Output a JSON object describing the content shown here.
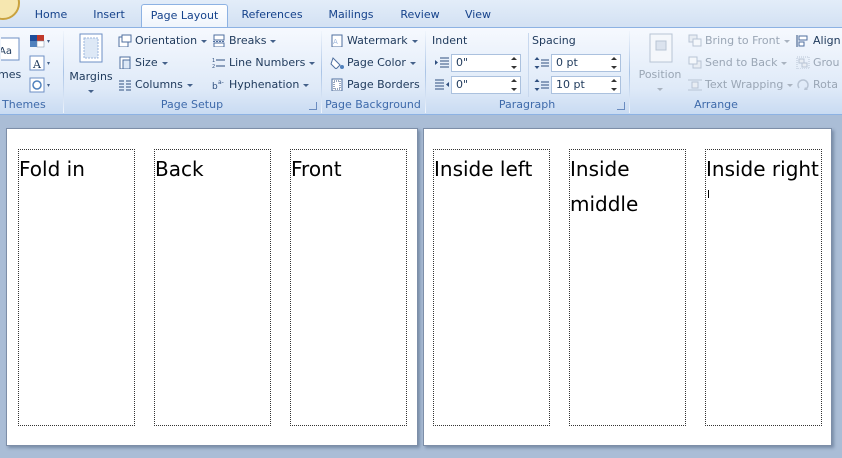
{
  "tabs": [
    {
      "label": "Home",
      "active": false
    },
    {
      "label": "Insert",
      "active": false
    },
    {
      "label": "Page Layout",
      "active": true
    },
    {
      "label": "References",
      "active": false
    },
    {
      "label": "Mailings",
      "active": false
    },
    {
      "label": "Review",
      "active": false
    },
    {
      "label": "View",
      "active": false
    }
  ],
  "ribbon": {
    "themes": {
      "label": "Themes",
      "button_fragment": "mes",
      "icon_text": "Aa"
    },
    "page_setup": {
      "label": "Page Setup",
      "margins": "Margins",
      "orientation": "Orientation",
      "size": "Size",
      "columns": "Columns",
      "breaks": "Breaks",
      "line_numbers": "Line Numbers",
      "hyphenation": "Hyphenation"
    },
    "page_background": {
      "label": "Page Background",
      "watermark": "Watermark",
      "page_color": "Page Color",
      "page_borders": "Page Borders"
    },
    "paragraph": {
      "label": "Paragraph",
      "indent_label": "Indent",
      "spacing_label": "Spacing",
      "indent_left": "0\"",
      "indent_right": "0\"",
      "spacing_before": "0 pt",
      "spacing_after": "10 pt"
    },
    "arrange": {
      "label": "Arrange",
      "position": "Position",
      "bring_to_front": "Bring to Front",
      "send_to_back": "Send to Back",
      "text_wrapping": "Text Wrapping",
      "align": "Align",
      "group": "Grou",
      "rotate": "Rota"
    }
  },
  "document": {
    "page1_panels": [
      "Fold in",
      "Back",
      "Front"
    ],
    "page2_panels": [
      "Inside left",
      "Inside\nmiddle",
      "Inside right"
    ]
  },
  "colors": {
    "ribbon_text": "#1e395b",
    "group_label": "#3e6aaa",
    "workspace": "#aabdd6"
  }
}
